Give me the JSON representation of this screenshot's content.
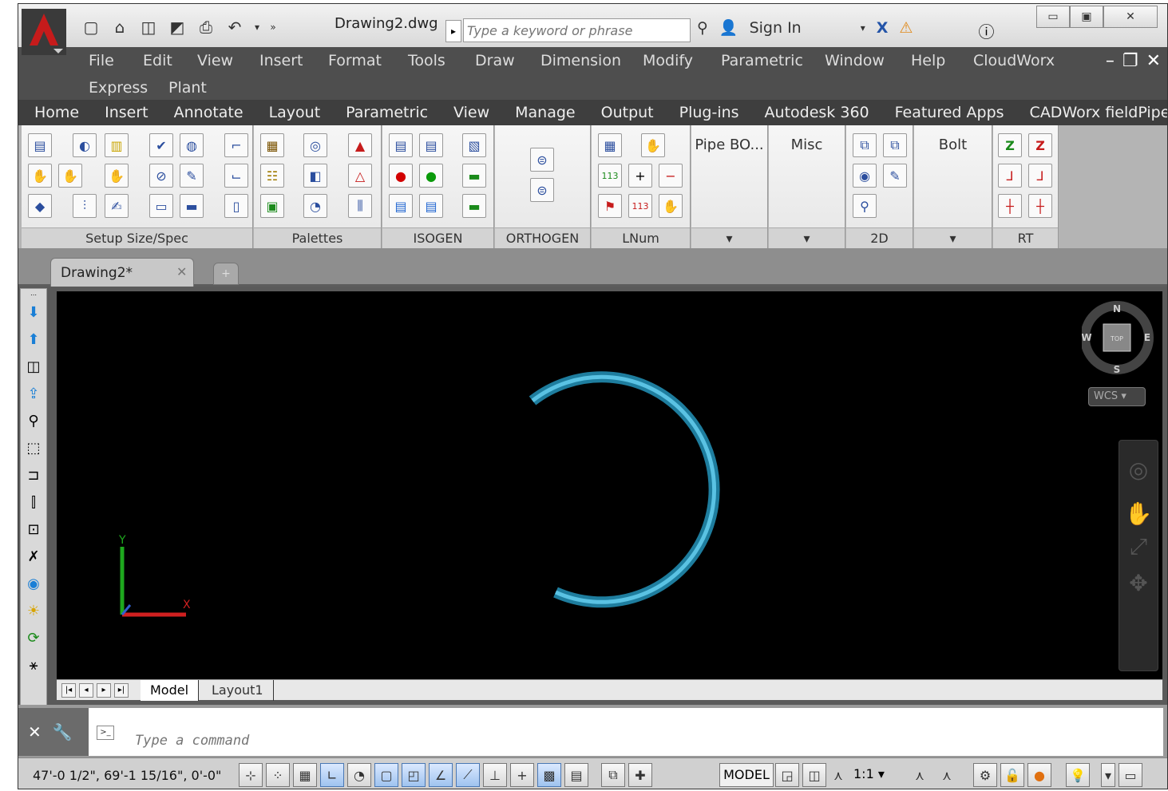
{
  "app": {
    "document_title": "Drawing2.dwg",
    "colors": {
      "brand_red": "#c61b1b",
      "canvas": "#000000",
      "pipe": "#2aa1c7",
      "ribbon": "#e6e6e6"
    }
  },
  "quick_access": {
    "icons": [
      "new-icon",
      "open-icon",
      "save-icon",
      "saveas-icon",
      "plot-icon",
      "undo-icon",
      "dropdown-icon",
      "more-icon"
    ]
  },
  "search": {
    "placeholder": "Type a keyword or phrase"
  },
  "account": {
    "sign_in": "Sign In"
  },
  "menu": {
    "items": [
      "File",
      "Edit",
      "View",
      "Insert",
      "Format",
      "Tools",
      "Draw",
      "Dimension",
      "Modify",
      "Parametric",
      "Window",
      "Help",
      "CloudWorx",
      "Express",
      "Plant"
    ]
  },
  "ribbon_tabs": [
    "Home",
    "Insert",
    "Annotate",
    "Layout",
    "Parametric",
    "View",
    "Manage",
    "Output",
    "Plug-ins",
    "Autodesk 360",
    "Featured Apps",
    "CADWorx fieldPipe"
  ],
  "ribbon_panels": [
    {
      "title": "Setup Size/Spec"
    },
    {
      "title": "Palettes"
    },
    {
      "title": "ISOGEN"
    },
    {
      "title": "ORTHOGEN"
    },
    {
      "title": "LNum"
    },
    {
      "title": "",
      "label": "Pipe BO..."
    },
    {
      "title": "",
      "label": "Misc"
    },
    {
      "title": "2D"
    },
    {
      "title": "",
      "label": "Bolt"
    },
    {
      "title": "RT"
    }
  ],
  "file_tabs": {
    "active": "Drawing2*"
  },
  "viewcube": {
    "n": "N",
    "s": "S",
    "e": "E",
    "w": "W",
    "top": "TOP",
    "wcs": "WCS"
  },
  "ucs": {
    "x": "X",
    "y": "Y"
  },
  "layout_tabs": {
    "model": "Model",
    "layout1": "Layout1"
  },
  "command": {
    "placeholder": "Type a command"
  },
  "status": {
    "coords": "47'-0 1/2\",  69'-1 15/16\", 0'-0\"",
    "model": "MODEL",
    "scale": "1:1"
  }
}
